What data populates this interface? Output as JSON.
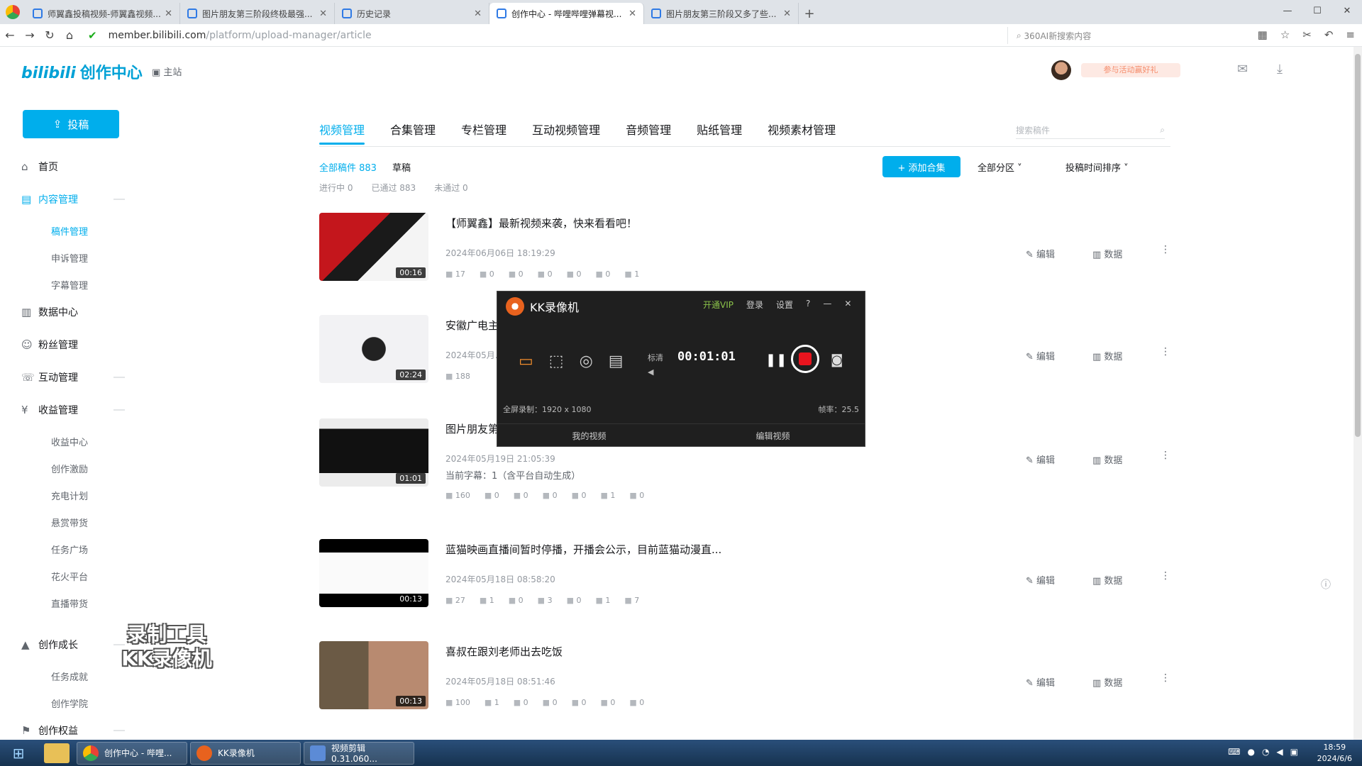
{
  "browser": {
    "tabs": [
      {
        "title": "师翼鑫投稿视频-师翼鑫视频..."
      },
      {
        "title": "图片朋友第三阶段终极最强..."
      },
      {
        "title": "历史记录"
      },
      {
        "title": "创作中心 - 哔哩哔哩弹幕视..."
      },
      {
        "title": "图片朋友第三阶段又多了些..."
      }
    ],
    "url_host": "member.bilibili.com",
    "url_path": "/platform/upload-manager/article",
    "search_placeholder": "360AI新搜索内容"
  },
  "header": {
    "logo_mark": "bilibili",
    "logo_text": "创作中心",
    "home_label": "主站",
    "user_badge": "参与活动赢好礼"
  },
  "sidebar": {
    "upload_label": "投稿",
    "items": [
      {
        "label": "首页",
        "icon": "home-icon"
      },
      {
        "label": "内容管理",
        "icon": "document-icon"
      },
      {
        "label": "稿件管理"
      },
      {
        "label": "申诉管理"
      },
      {
        "label": "字幕管理"
      },
      {
        "label": "数据中心",
        "icon": "chart-icon"
      },
      {
        "label": "粉丝管理",
        "icon": "user-icon"
      },
      {
        "label": "互动管理",
        "icon": "chat-icon"
      },
      {
        "label": "收益管理",
        "icon": "wallet-icon"
      },
      {
        "label": "收益中心"
      },
      {
        "label": "创作激励"
      },
      {
        "label": "充电计划"
      },
      {
        "label": "悬赏带货"
      },
      {
        "label": "任务广场"
      },
      {
        "label": "花火平台"
      },
      {
        "label": "直播带货"
      },
      {
        "label": "创作成长",
        "icon": "grow-icon"
      },
      {
        "label": "任务成就"
      },
      {
        "label": "创作学院"
      },
      {
        "label": "创作权益",
        "icon": "flag-icon"
      }
    ]
  },
  "watermark": {
    "line1": "录制工具",
    "line2": "KK录像机"
  },
  "main": {
    "tabs": [
      "视频管理",
      "合集管理",
      "专栏管理",
      "互动视频管理",
      "音频管理",
      "贴纸管理",
      "视频素材管理"
    ],
    "search_placeholder": "搜索稿件",
    "filters": {
      "all": "全部稿件 883",
      "draft": "草稿"
    },
    "status": {
      "progress": "进行中 0",
      "passed": "已通过 883",
      "failed": "未通过 0"
    },
    "add_collection": "+ 添加合集",
    "partition": "全部分区",
    "sort": "投稿时间排序",
    "edit_label": "编辑",
    "data_label": "数据",
    "videos": [
      {
        "title": "【师翼鑫】最新视频来袭，快来看看吧！",
        "date": "2024年06月06日 18:19:29",
        "duration": "00:16",
        "stats": [
          "17",
          "0",
          "0",
          "0",
          "0",
          "0",
          "1"
        ]
      },
      {
        "title": "安徽广电主...",
        "date": "2024年05月...",
        "duration": "02:24",
        "stats": [
          "188"
        ]
      },
      {
        "title": "图片朋友第...",
        "date": "2024年05月19日 21:05:39",
        "duration": "01:01",
        "subtitle": "当前字幕：1（含平台自动生成）",
        "stats": [
          "160",
          "0",
          "0",
          "0",
          "0",
          "1",
          "0"
        ]
      },
      {
        "title": "蓝猫映画直播间暂时停播，开播会公示，目前蓝猫动漫直...",
        "date": "2024年05月18日 08:58:20",
        "duration": "00:13",
        "stats": [
          "27",
          "1",
          "0",
          "3",
          "0",
          "1",
          "7"
        ]
      },
      {
        "title": "喜叔在跟刘老师出去吃饭",
        "date": "2024年05月18日 08:51:46",
        "duration": "00:13",
        "stats": [
          "100",
          "1",
          "0",
          "0",
          "0",
          "0",
          "0"
        ]
      }
    ]
  },
  "recorder": {
    "title": "KK录像机",
    "menu_vip": "开通VIP",
    "menu_login": "登录",
    "menu_settings": "设置",
    "quality": "标清",
    "time": "00:01:01",
    "area_info": "全屏录制：1920 x 1080",
    "fps_info": "帧率：25.5",
    "my_videos": "我的视频",
    "edit_video": "编辑视频"
  },
  "taskbar": {
    "apps": [
      {
        "label": "创作中心 - 哔哩..."
      },
      {
        "label": "KK录像机"
      },
      {
        "label": "视频剪辑 0.31.060..."
      }
    ],
    "time": "18:59",
    "date": "2024/6/6"
  },
  "colors": {
    "accent": "#00aeec",
    "recorder_bg": "#1f1f1f",
    "stop": "#e8141e"
  }
}
